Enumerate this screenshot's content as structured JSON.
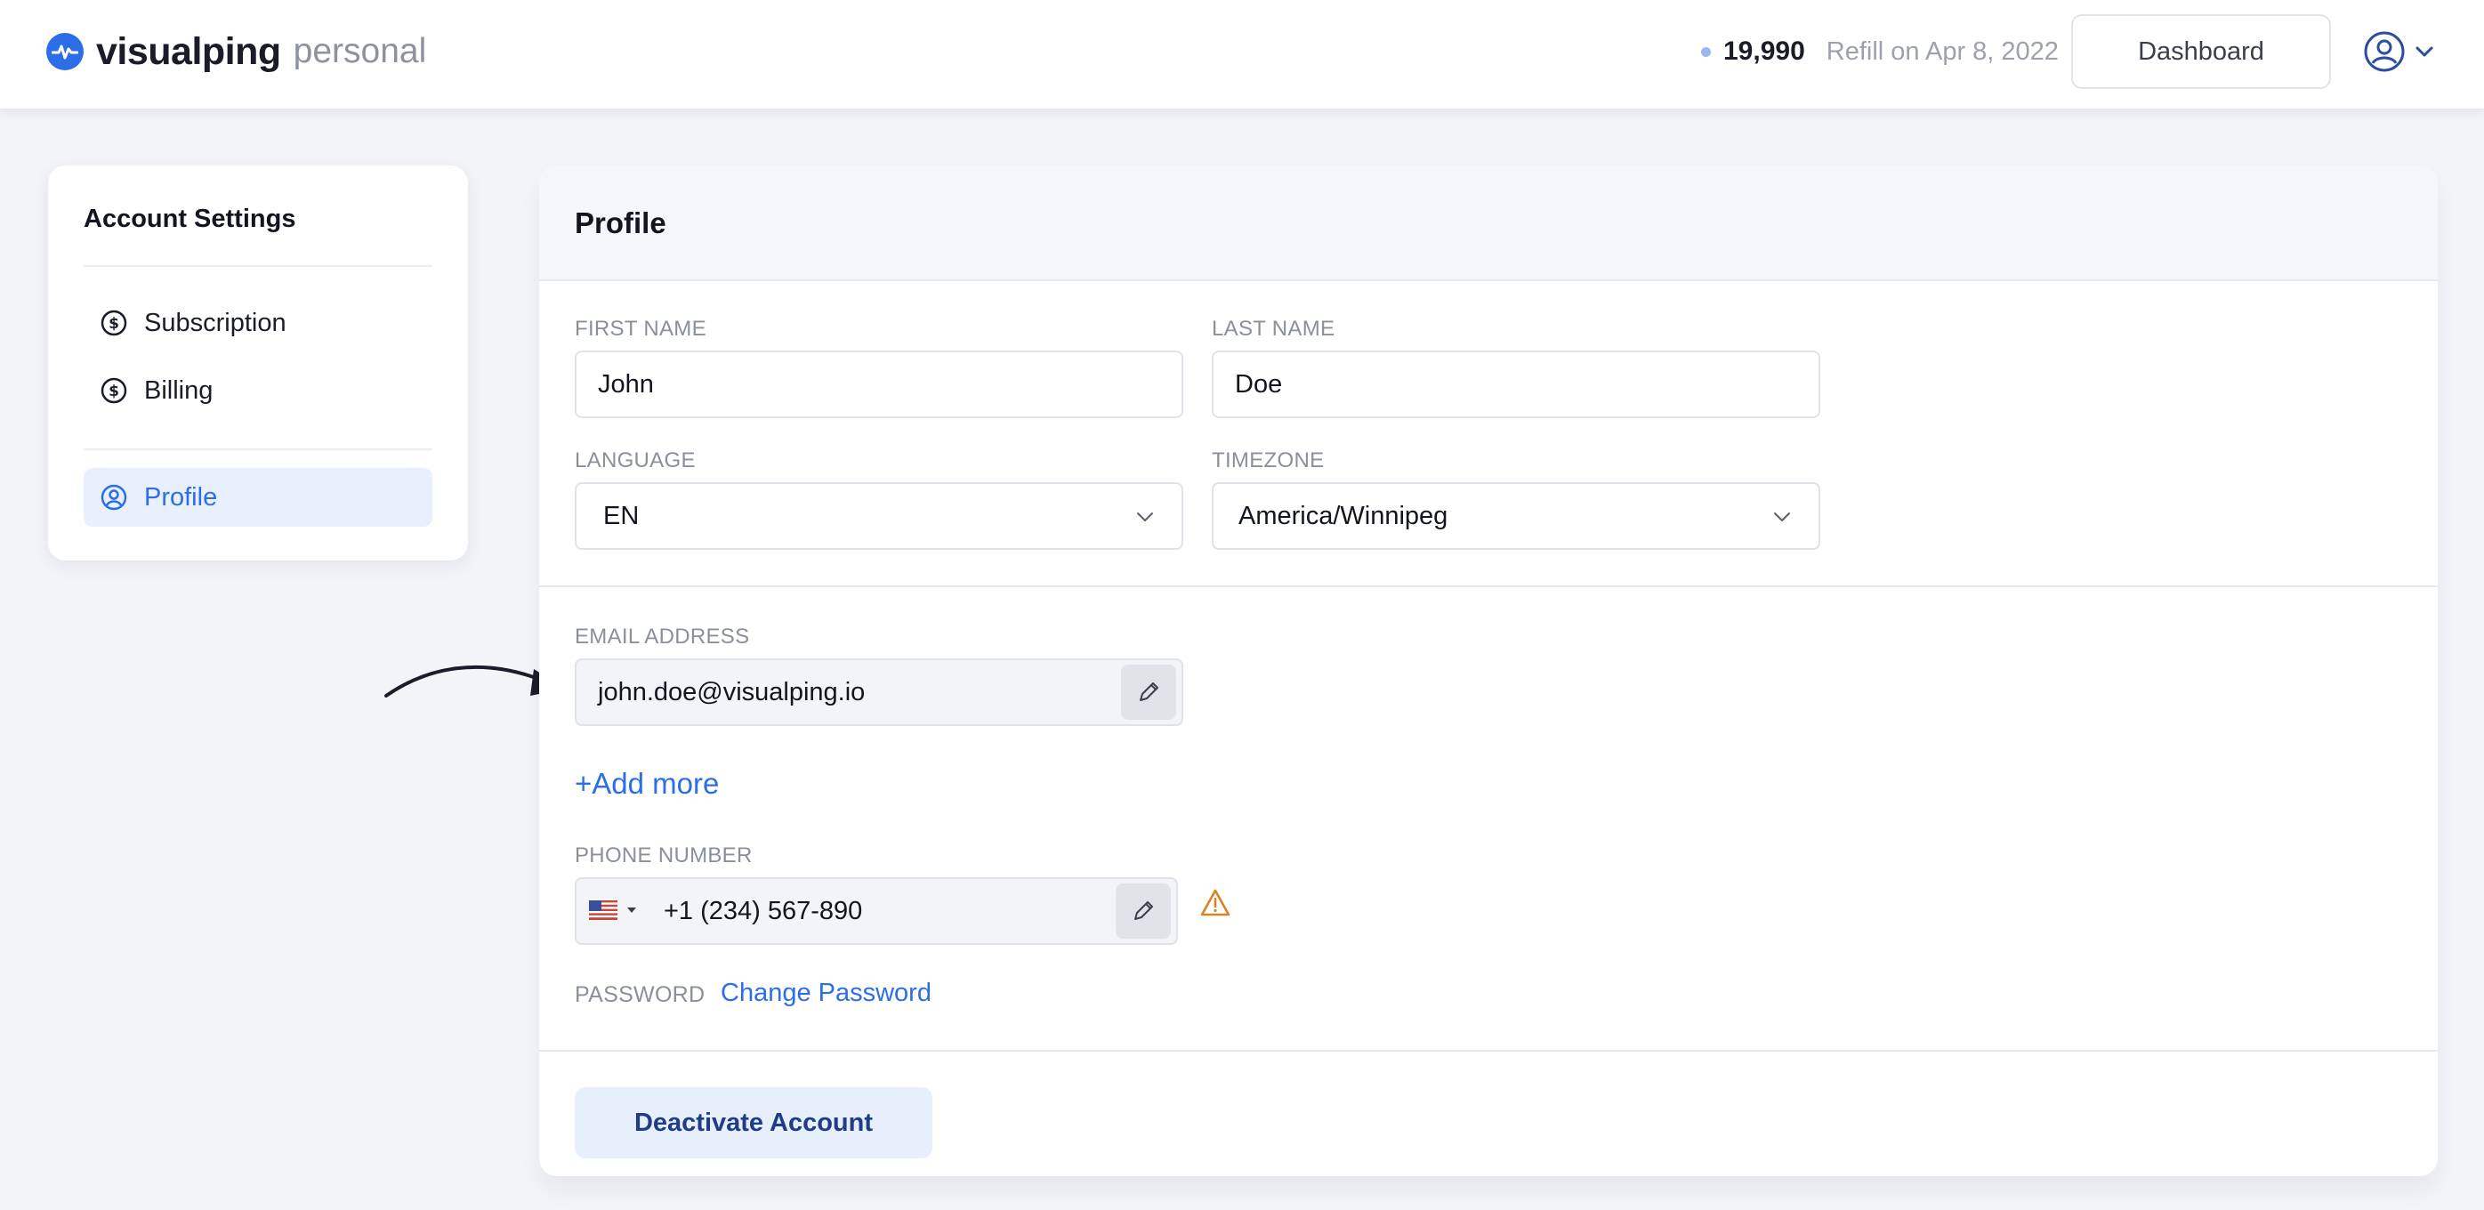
{
  "header": {
    "logo_word": "visualping",
    "logo_sub": "personal",
    "credits": "19,990",
    "refill": "Refill on Apr 8, 2022",
    "dashboard_label": "Dashboard"
  },
  "sidebar": {
    "title": "Account Settings",
    "items": [
      {
        "label": "Subscription",
        "icon": "dollar-circle-icon"
      },
      {
        "label": "Billing",
        "icon": "dollar-circle-icon"
      },
      {
        "label": "Profile",
        "icon": "user-circle-icon",
        "active": true
      }
    ]
  },
  "profile": {
    "title": "Profile",
    "first_name_label": "FIRST NAME",
    "first_name": "John",
    "last_name_label": "LAST NAME",
    "last_name": "Doe",
    "language_label": "LANGUAGE",
    "language": "EN",
    "timezone_label": "TIMEZONE",
    "timezone": "America/Winnipeg",
    "email_label": "EMAIL ADDRESS",
    "email": "john.doe@visualping.io",
    "add_more": "+Add more",
    "phone_label": "PHONE NUMBER",
    "phone": "+1 (234) 567-890",
    "password_label": "PASSWORD",
    "change_password": "Change Password",
    "deactivate": "Deactivate Account"
  },
  "colors": {
    "accent": "#2c6ee8",
    "warning": "#d98324",
    "background": "#f3f4f8"
  }
}
